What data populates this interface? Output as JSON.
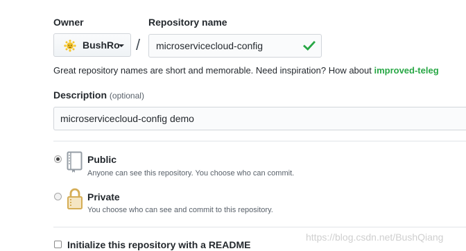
{
  "owner": {
    "label": "Owner",
    "selected": "BushRo"
  },
  "repository": {
    "label": "Repository name",
    "value": "microservicecloud-config",
    "valid": true
  },
  "separator": "/",
  "hint": {
    "text": "Great repository names are short and memorable. Need inspiration? How about ",
    "suggestion": "improved-teleg"
  },
  "description": {
    "label": "Description",
    "optional_tag": "(optional)",
    "value": "microservicecloud-config demo"
  },
  "visibility": {
    "options": [
      {
        "title": "Public",
        "desc": "Anyone can see this repository. You choose who can commit.",
        "selected": true
      },
      {
        "title": "Private",
        "desc": "You choose who can see and commit to this repository.",
        "selected": false
      }
    ]
  },
  "readme": {
    "label": "Initialize this repository with a README",
    "checked": false
  },
  "watermark": "https://blog.csdn.net/BushQiang",
  "colors": {
    "success": "#28a745",
    "text": "#24292e",
    "muted": "#586069",
    "border": "#d1d5da"
  }
}
